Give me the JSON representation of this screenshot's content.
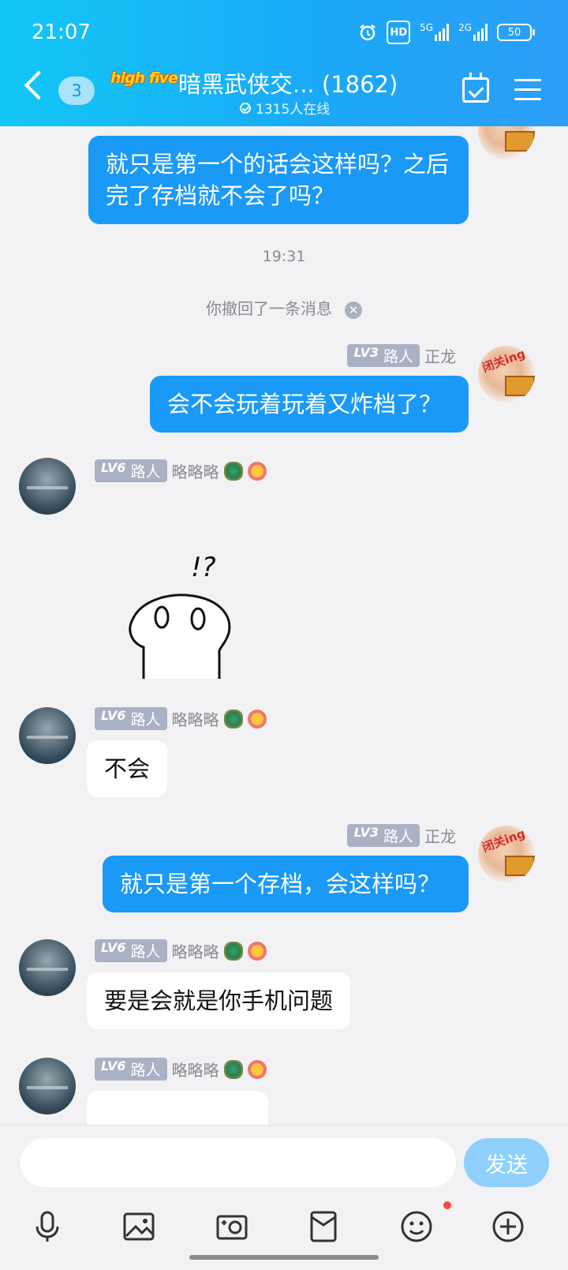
{
  "status_bar": {
    "time": "21:07",
    "alarm_icon": "alarm-icon",
    "hd_label": "HD",
    "net1": "5G",
    "net2": "2G",
    "battery": "50"
  },
  "header": {
    "back_icon": "chevron-left-icon",
    "unread_count": "3",
    "logo_text": "high five",
    "group_title": "暗黑武侠交... (1862)",
    "online_text": "1315人在线",
    "calendar_icon": "calendar-check-icon",
    "menu_icon": "menu-icon"
  },
  "messages": [
    {
      "id": "m1",
      "from": "me",
      "text": "就只是第一个的话会这样吗？之后完了存档就不会了吗？"
    },
    {
      "id": "t1",
      "type": "time",
      "text": "19:31"
    },
    {
      "id": "r1",
      "type": "revoke",
      "text": "你撤回了一条消息"
    },
    {
      "id": "m2",
      "from": "me",
      "level": "LV3",
      "role": "路人",
      "name": "正龙",
      "avatar_tag": "闭关ing",
      "text": "会不会玩着玩着又炸档了？"
    },
    {
      "id": "m3",
      "from": "other",
      "level": "LV6",
      "role": "路人",
      "name": "略略略",
      "sticker": "!?"
    },
    {
      "id": "m4",
      "from": "other",
      "level": "LV6",
      "role": "路人",
      "name": "略略略",
      "text": "不会"
    },
    {
      "id": "m5",
      "from": "me",
      "level": "LV3",
      "role": "路人",
      "name": "正龙",
      "avatar_tag": "闭关ing",
      "text": "就只是第一个存档，会这样吗？"
    },
    {
      "id": "m6",
      "from": "other",
      "level": "LV6",
      "role": "路人",
      "name": "略略略",
      "text": "要是会就是你手机问题"
    },
    {
      "id": "m7",
      "from": "other",
      "level": "LV6",
      "role": "路人",
      "name": "略略略",
      "text": ""
    }
  ],
  "input_bar": {
    "placeholder": "",
    "send_label": "发送"
  },
  "toolbar": {
    "items": [
      "microphone-icon",
      "image-icon",
      "camera-icon",
      "red-packet-icon",
      "emoji-icon",
      "plus-icon"
    ]
  },
  "colors": {
    "header_start": "#13c7f5",
    "header_end": "#2c9ef7",
    "bubble_me": "#1a99f6",
    "bubble_other": "#ffffff",
    "background": "#f2f2f4",
    "level_badge": "#a9b1c5",
    "send_button": "#8fd0fb"
  }
}
